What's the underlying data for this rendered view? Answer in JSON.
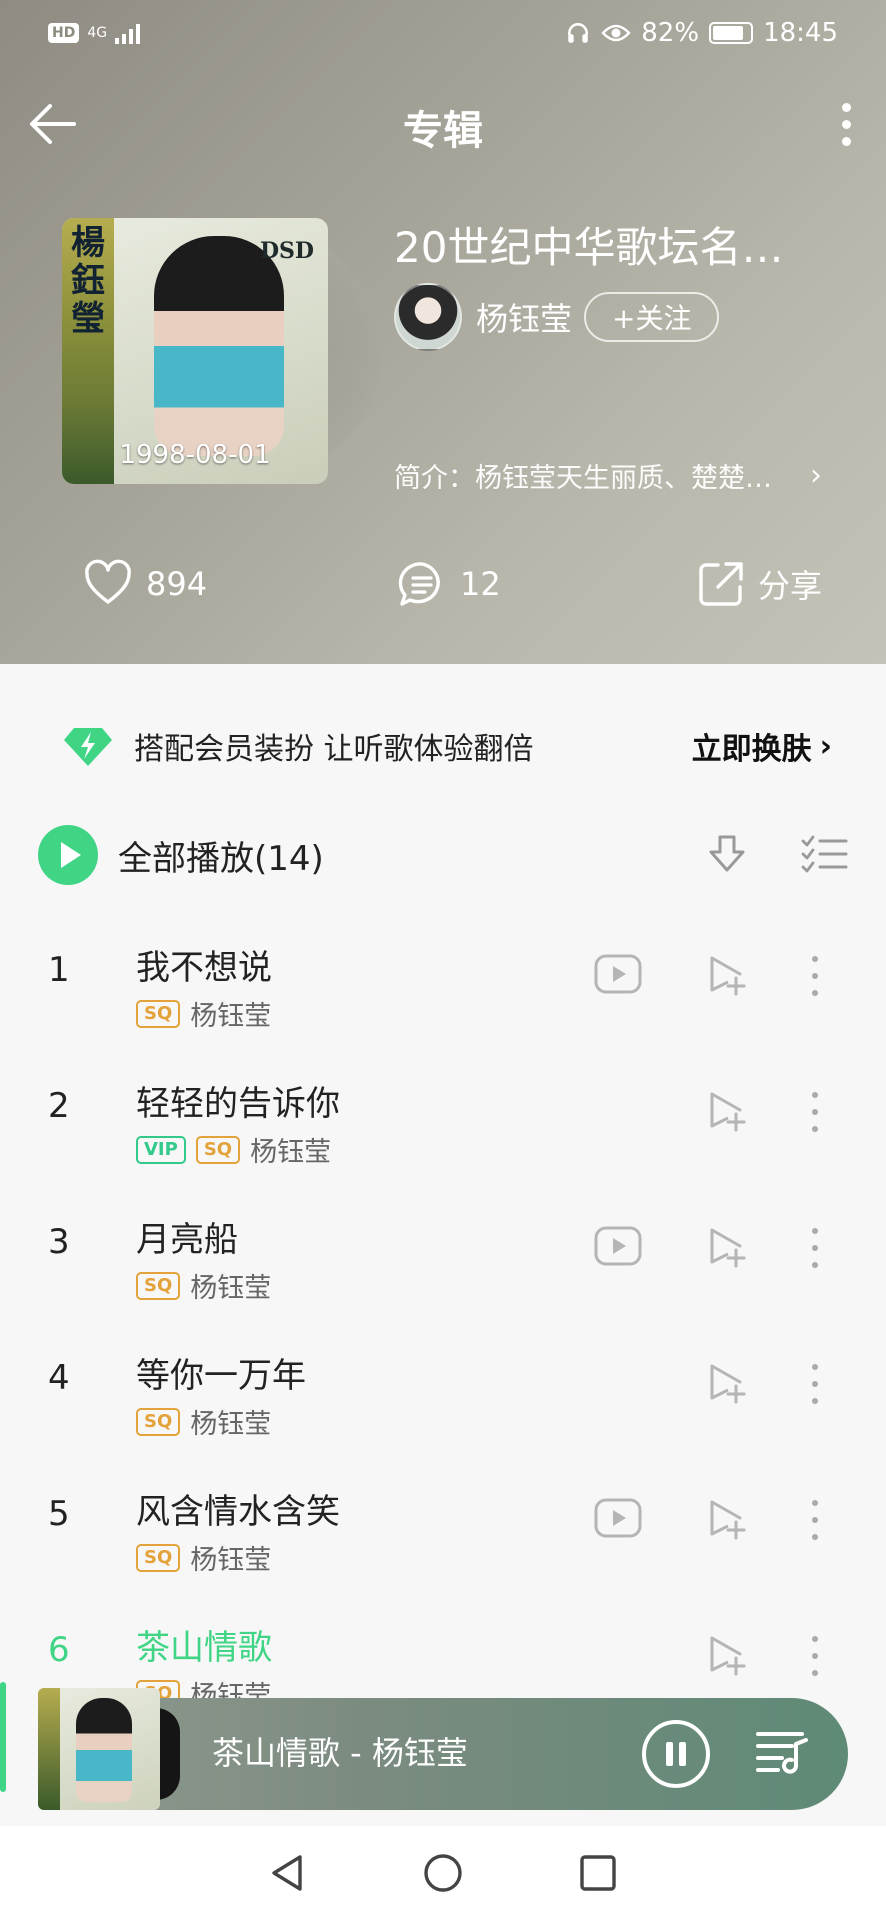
{
  "status": {
    "network": "4G",
    "battery": "82%",
    "time": "18:45"
  },
  "topbar": {
    "title": "专辑"
  },
  "album": {
    "cover_date": "1998-08-01",
    "cover_text_vertical": "楊鈺瑩",
    "cover_brand": "DSD",
    "title": "20世纪中华歌坛名…",
    "artist": "杨钰莹",
    "follow_label": "+关注",
    "intro": "简介：杨钰莹天生丽质、楚楚…",
    "intro_chevron": "›"
  },
  "actions": {
    "likes": "894",
    "comments": "12",
    "share": "分享"
  },
  "promo": {
    "text": "搭配会员装扮  让听歌体验翻倍",
    "cta": "立即换肤",
    "cta_chevron": "›"
  },
  "playall": {
    "label": "全部播放(14)"
  },
  "songs": [
    {
      "num": "1",
      "name": "我不想说",
      "tags": [
        "SQ"
      ],
      "artist": "杨钰莹",
      "mv": true
    },
    {
      "num": "2",
      "name": "轻轻的告诉你",
      "tags": [
        "VIP",
        "SQ"
      ],
      "artist": "杨钰莹",
      "mv": false
    },
    {
      "num": "3",
      "name": "月亮船",
      "tags": [
        "SQ"
      ],
      "artist": "杨钰莹",
      "mv": true
    },
    {
      "num": "4",
      "name": "等你一万年",
      "tags": [
        "SQ"
      ],
      "artist": "杨钰莹",
      "mv": false
    },
    {
      "num": "5",
      "name": "风含情水含笑",
      "tags": [
        "SQ"
      ],
      "artist": "杨钰莹",
      "mv": true
    },
    {
      "num": "6",
      "name": "茶山情歌",
      "tags": [
        "SQ"
      ],
      "artist": "杨钰莹",
      "mv": false,
      "active": true
    }
  ],
  "player": {
    "track": "茶山情歌 - 杨钰莹"
  },
  "colors": {
    "accent": "#3fd585",
    "sq": "#e3a23a",
    "vip": "#33c98b"
  },
  "icons": [
    "back-arrow-icon",
    "more-vertical-icon",
    "heart-icon",
    "comment-icon",
    "share-icon",
    "diamond-bolt-icon",
    "download-icon",
    "multi-select-icon",
    "mv-play-icon",
    "add-to-queue-icon",
    "pause-icon",
    "playlist-icon",
    "nav-back-icon",
    "nav-home-icon",
    "nav-recents-icon"
  ]
}
